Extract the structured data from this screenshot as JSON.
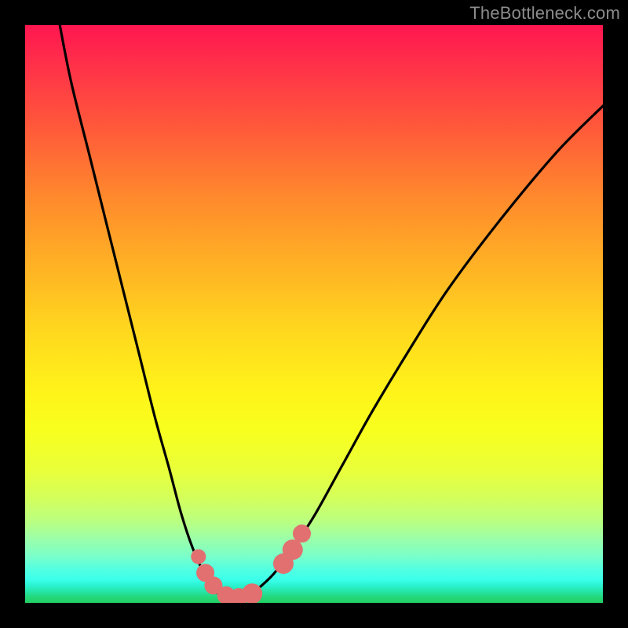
{
  "watermark": "TheBottleneck.com",
  "chart_data": {
    "type": "line",
    "title": "",
    "xlabel": "",
    "ylabel": "",
    "xlim": [
      0,
      100
    ],
    "ylim": [
      0,
      100
    ],
    "grid": false,
    "legend": null,
    "series": [
      {
        "name": "bottleneck-curve",
        "x": [
          6,
          8,
          11,
          14,
          17,
          20,
          22.5,
          25,
          27,
          29,
          31,
          32.5,
          34,
          36,
          38,
          40,
          43,
          46,
          50,
          55,
          60,
          66,
          73,
          82,
          92,
          100
        ],
        "y": [
          100,
          90,
          78,
          66,
          54,
          42,
          32,
          23,
          15.5,
          9.5,
          5,
          2.5,
          1.2,
          0.6,
          0.9,
          2.2,
          5,
          9,
          15,
          24,
          33,
          43,
          54,
          66,
          78,
          86
        ]
      }
    ],
    "markers": [
      {
        "name": "left-cluster-upper",
        "x": 30.0,
        "y": 8.0,
        "size": "sm"
      },
      {
        "name": "left-cluster-mid",
        "x": 31.2,
        "y": 5.2,
        "size": "md"
      },
      {
        "name": "left-cluster-lower",
        "x": 32.6,
        "y": 3.0,
        "size": "md"
      },
      {
        "name": "valley-left",
        "x": 34.8,
        "y": 1.3,
        "size": "md"
      },
      {
        "name": "valley-mid",
        "x": 37.0,
        "y": 1.0,
        "size": "md"
      },
      {
        "name": "valley-right",
        "x": 39.3,
        "y": 1.6,
        "size": "lg"
      },
      {
        "name": "right-cluster-lower",
        "x": 44.7,
        "y": 6.8,
        "size": "lg"
      },
      {
        "name": "right-cluster-mid",
        "x": 46.3,
        "y": 9.2,
        "size": "lg"
      },
      {
        "name": "right-cluster-upper",
        "x": 47.9,
        "y": 12.0,
        "size": "md"
      }
    ],
    "background_gradient": {
      "top": "#ff1650",
      "mid": "#fff21a",
      "bottom": "#22cf63"
    }
  }
}
